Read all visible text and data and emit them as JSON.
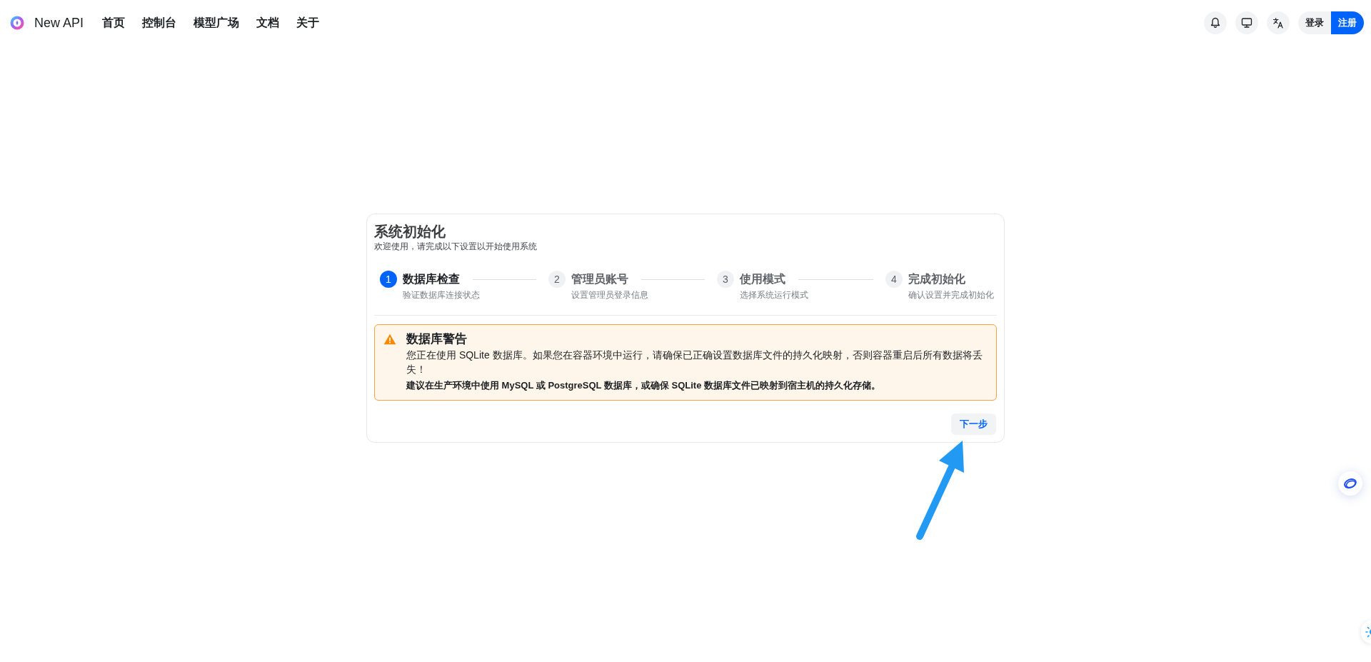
{
  "header": {
    "brand": "New API",
    "nav": [
      "首页",
      "控制台",
      "模型广场",
      "文档",
      "关于"
    ],
    "auth_buttons": [
      {
        "label": "登录",
        "kind": "secondary"
      },
      {
        "label": "注册",
        "kind": "primary"
      }
    ]
  },
  "setup_card": {
    "title": "系统初始化",
    "subtitle": "欢迎使用，请完成以下设置以开始使用系统",
    "steps": [
      {
        "number": "1",
        "title": "数据库检查",
        "description": "验证数据库连接状态",
        "current": true
      },
      {
        "number": "2",
        "title": "管理员账号",
        "description": "设置管理员登录信息",
        "current": false
      },
      {
        "number": "3",
        "title": "使用模式",
        "description": "选择系统运行模式",
        "current": false
      },
      {
        "number": "4",
        "title": "完成初始化",
        "description": "确认设置并完成初始化",
        "current": false
      }
    ],
    "alert": {
      "kind": "warning",
      "title": "数据库警告",
      "message": "您正在使用 SQLite 数据库。如果您在容器环境中运行，请确保已正确设置数据库文件的持久化映射，否则容器重启后所有数据将丢失！",
      "recommendation": "建议在生产环境中使用 MySQL 或 PostgreSQL 数据库，或确保 SQLite 数据库文件已映射到宿主机的持久化存储。"
    },
    "next_button": "下一步"
  }
}
